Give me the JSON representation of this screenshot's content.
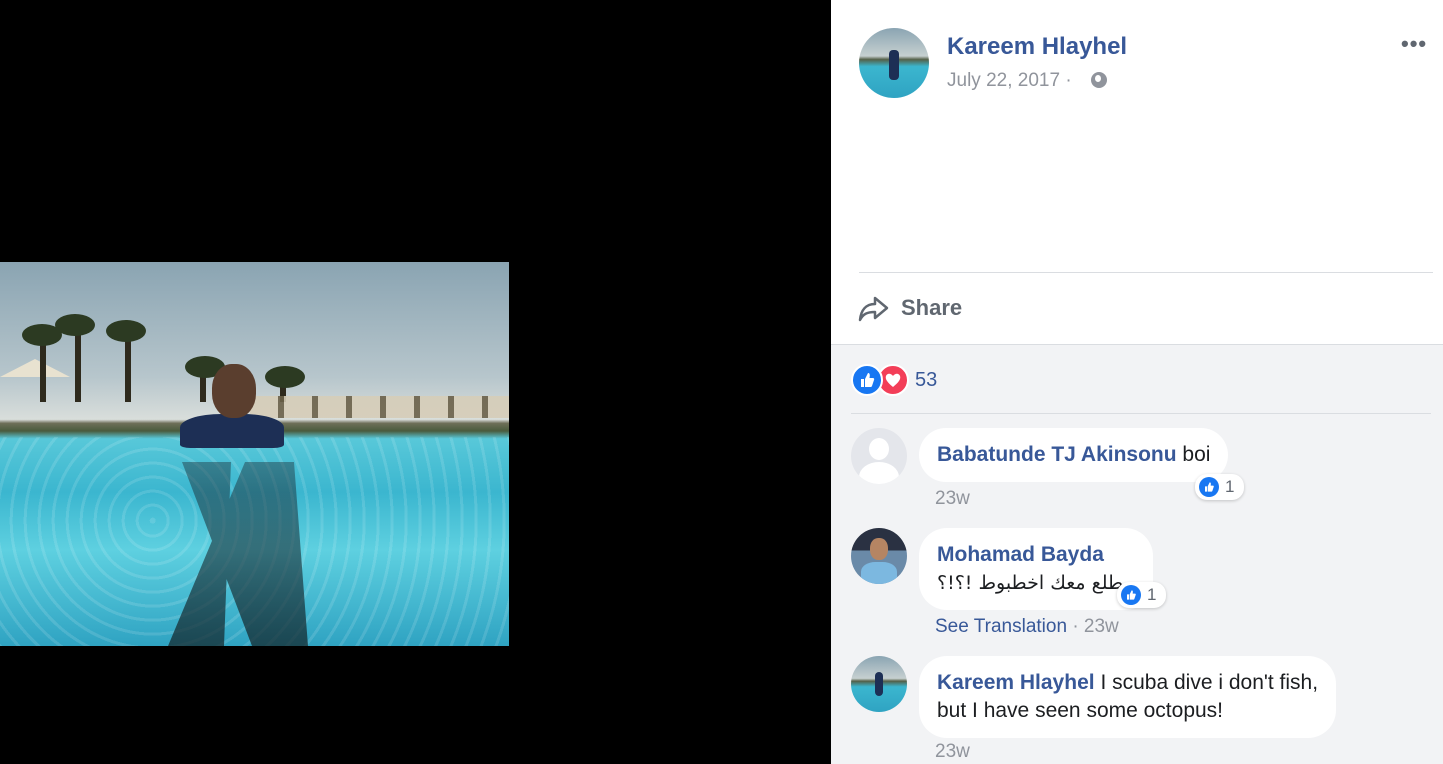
{
  "post": {
    "author": "Kareem Hlayhel",
    "date": "July 22, 2017",
    "date_separator": "·",
    "more": "•••",
    "share_label": "Share"
  },
  "reactions": {
    "count": "53"
  },
  "comments": [
    {
      "author": "Babatunde TJ Akinsonu",
      "text": "boi",
      "time": "23w",
      "likes": "1"
    },
    {
      "author": "Mohamad Bayda",
      "text": "بيطلع معك اخطبوط !؟!؟",
      "see_translation": "See Translation",
      "separator": "·",
      "time": "23w",
      "likes": "1"
    },
    {
      "author": "Kareem Hlayhel",
      "text_line1": "I scuba dive i don't fish,",
      "text_line2": "but I have seen some octopus!",
      "time": "23w"
    }
  ],
  "icons": {
    "globe": "globe-icon",
    "more": "more-icon",
    "share": "share-icon",
    "like": "like-reaction-icon",
    "love": "love-reaction-icon"
  },
  "colors": {
    "link": "#385898",
    "meta": "#90949c",
    "panel_bg": "#f2f3f5",
    "like": "#1877f2",
    "love": "#f33e58"
  }
}
